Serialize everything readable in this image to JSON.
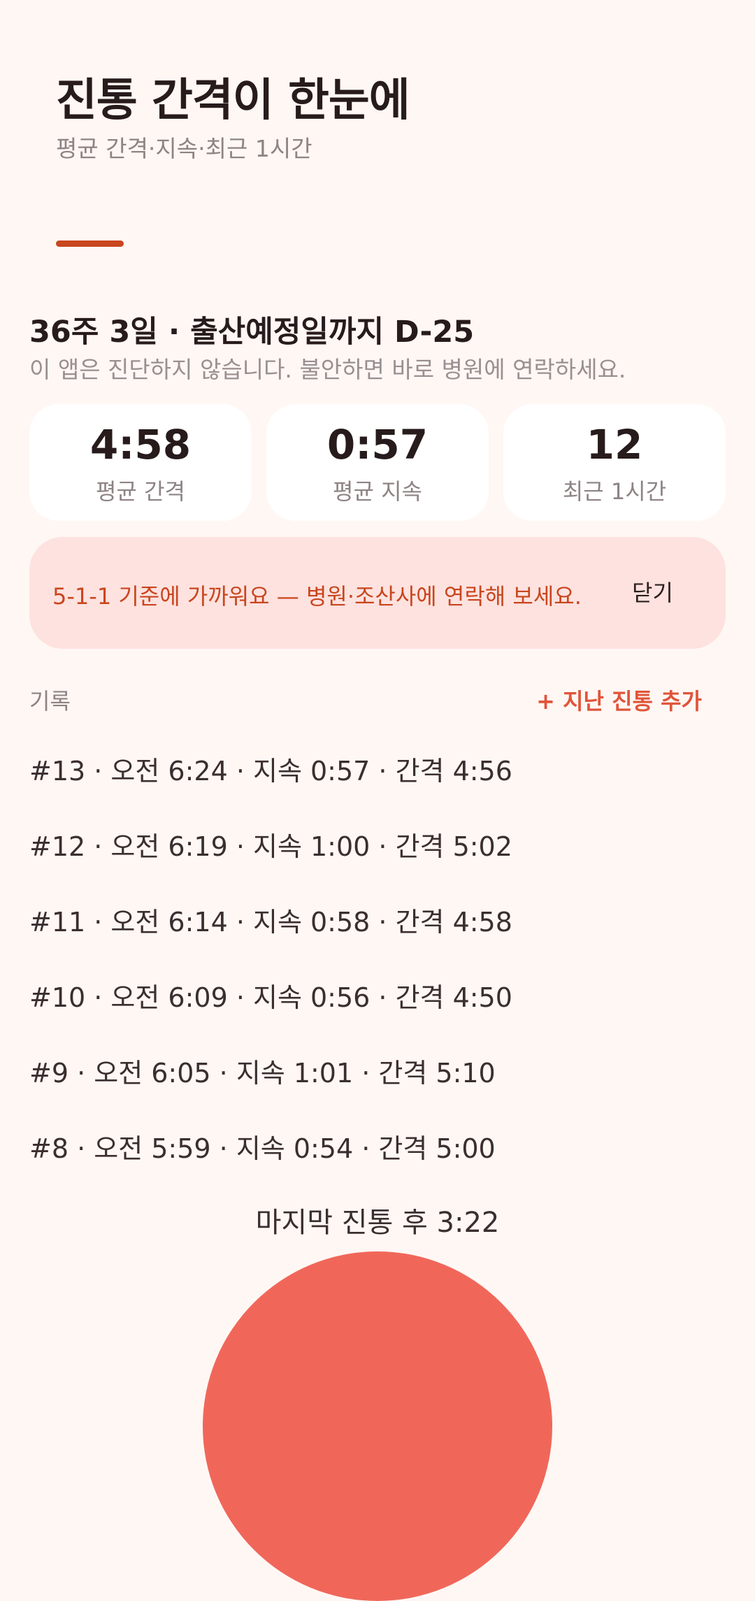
{
  "header": {
    "title": "진통 간격이 한눈에",
    "subtitle": "평균 간격·지속·최근 1시간"
  },
  "pregnancy": {
    "week_line": "36주 3일 · 출산예정일까지 D-25",
    "disclaimer": "이 앱은 진단하지 않습니다. 불안하면 바로 병원에 연락하세요."
  },
  "stats": [
    {
      "value": "4:58",
      "label": "평균 간격"
    },
    {
      "value": "0:57",
      "label": "평균 지속"
    },
    {
      "value": "12",
      "label": "최근 1시간"
    }
  ],
  "alert": {
    "message": "5-1-1 기준에 가까워요 — 병원·조산사에 연락해 보세요.",
    "close_label": "닫기"
  },
  "log": {
    "section_label": "기록",
    "add_label": "+ 지난 진통 추가",
    "rows": [
      "#13 · 오전 6:24 · 지속 0:57 · 간격 4:56",
      "#12 · 오전 6:19 · 지속 1:00 · 간격 5:02",
      "#11 · 오전 6:14 · 지속 0:58 · 간격 4:58",
      "#10 · 오전 6:09 · 지속 0:56 · 간격 4:50",
      "#9 · 오전 6:05 · 지속 1:01 · 간격 5:10",
      "#8 · 오전 5:59 · 지속 0:54 · 간격 5:00"
    ]
  },
  "timer": {
    "since_last": "마지막 진통 후 3:22"
  },
  "colors": {
    "background": "#FFF7F4",
    "accent": "#C9461E",
    "alert_bg": "#FDE2DF",
    "add_link": "#E0553A",
    "main_button": "#F0675A"
  }
}
